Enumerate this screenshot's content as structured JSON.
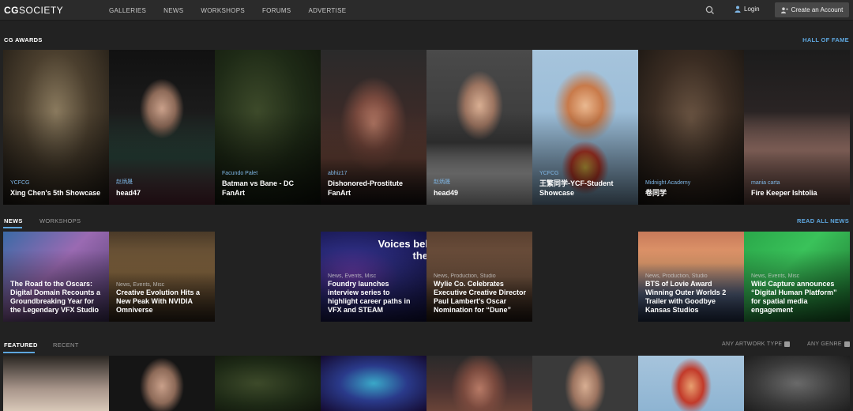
{
  "nav": {
    "logo_bold": "CG",
    "logo_rest": "SOCIETY",
    "links": [
      "GALLERIES",
      "NEWS",
      "WORKSHOPS",
      "FORUMS",
      "ADVERTISE"
    ],
    "login": "Login",
    "create": "Create an Account"
  },
  "awards": {
    "title": "CG AWARDS",
    "link": "HALL OF FAME",
    "cards": [
      {
        "author": "YCFCG",
        "title": "Xing Chen's 5th Showcase"
      },
      {
        "author": "赵炳晟",
        "title": "head47"
      },
      {
        "author": "Facundo Palet",
        "title": "Batman vs Bane - DC FanArt"
      },
      {
        "author": "abhiz17",
        "title": "Dishonored-Prostitute FanArt"
      },
      {
        "author": "赵炳晟",
        "title": "head49"
      },
      {
        "author": "YCFCG",
        "title": "王繁同学-YCF-Student Showcase"
      },
      {
        "author": "Midnight Academy",
        "title": "卷同学"
      },
      {
        "author": "mania carta",
        "title": "Fire Keeper Ishtolia"
      }
    ]
  },
  "news": {
    "tab_news": "NEWS",
    "tab_workshops": "WORKSHOPS",
    "link": "READ ALL NEWS",
    "cards": [
      {
        "cat": "",
        "title": "The Road to the Oscars: Digital Domain Recounts a Groundbreaking Year for the Legendary VFX Studio"
      },
      {
        "cat": "News, Events, Misc",
        "title": "Creative Evolution Hits a New Peak With NVIDIA Omniverse"
      },
      {
        "cat": "News, Events, Misc",
        "title": "Foundry launches interview series to highlight career paths in VFX and STEAM"
      },
      {
        "cat": "News, Production, Studio",
        "title": "Wylie Co. Celebrates Executive Creative Director Paul Lambert's Oscar Nomination for “Dune”"
      },
      {
        "cat": "News, Production, Studio",
        "title": "BTS of Lovie Award Winning Outer Worlds 2 Trailer with Goodbye Kansas Studios"
      },
      {
        "cat": "News, Events, Misc",
        "title": "Wild Capture announces “Digital Human Platform” for spatial media engagement"
      }
    ],
    "banner_text": "Voices bel the"
  },
  "featured": {
    "tab_featured": "FEATURED",
    "tab_recent": "RECENT",
    "filter_type": "ANY ARTWORK TYPE",
    "filter_genre": "ANY GENRE"
  },
  "colors": {
    "accent": "#5ea6de",
    "bg": "#222222",
    "nav": "#2b2b2b"
  }
}
